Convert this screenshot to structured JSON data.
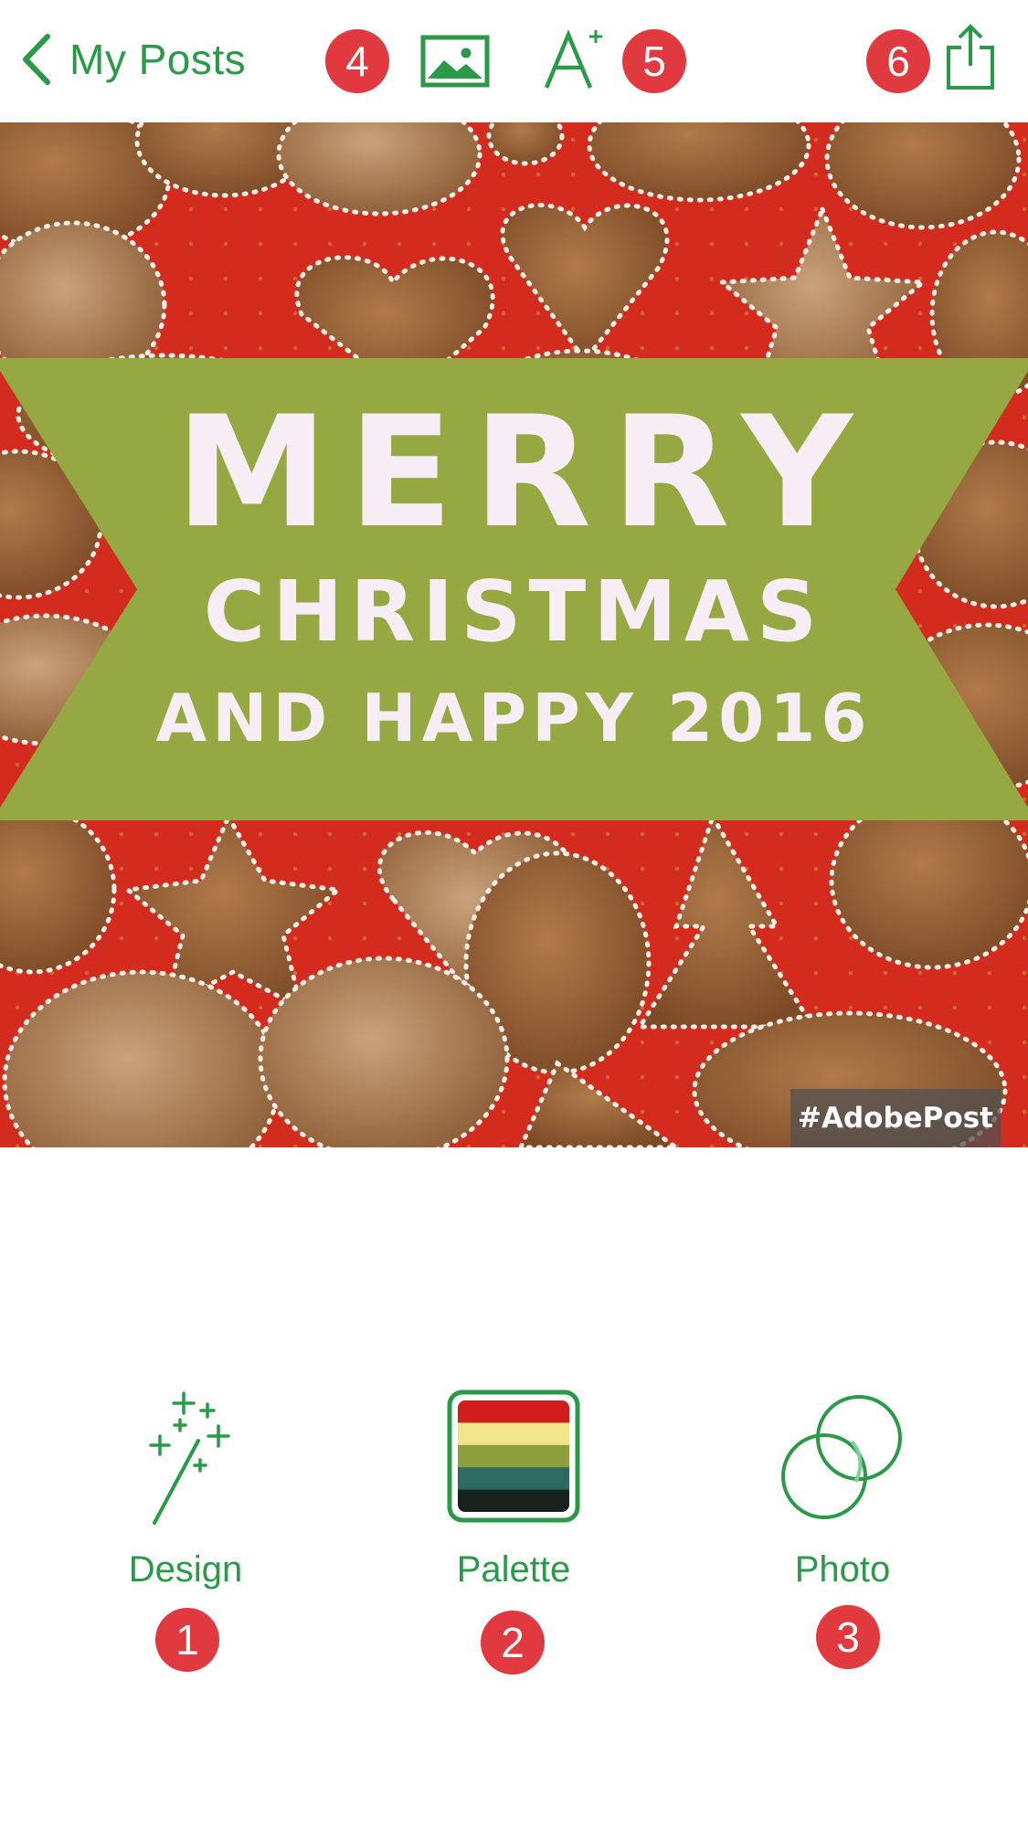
{
  "nav": {
    "back_label": "My Posts"
  },
  "toolbar": {
    "image_icon": "image-icon",
    "text_add_icon": "text-add-icon",
    "text_add_glyph": "A",
    "text_add_plus": "+",
    "share_icon": "share-icon"
  },
  "badges": {
    "b1": "1",
    "b2": "2",
    "b3": "3",
    "b4": "4",
    "b5": "5",
    "b6": "6"
  },
  "post": {
    "line1": "MERRY",
    "line2": "CHRISTMAS",
    "line3": "AND HAPPY 2016",
    "watermark": "#AdobePost",
    "banner_color": "#95a842",
    "background_color": "#d32b1e",
    "text_color": "#f6eef4"
  },
  "tabs": {
    "design": {
      "label": "Design",
      "icon": "magic-wand-icon"
    },
    "palette": {
      "label": "Palette",
      "icon": "palette-swatch-icon",
      "swatches": [
        "#d21d1d",
        "#f1e58a",
        "#8c9f3e",
        "#2e6a61",
        "#18221d"
      ]
    },
    "photo": {
      "label": "Photo",
      "icon": "photo-filter-icon"
    }
  },
  "colors": {
    "accent": "#2a9a48",
    "badge": "#e03a40"
  }
}
